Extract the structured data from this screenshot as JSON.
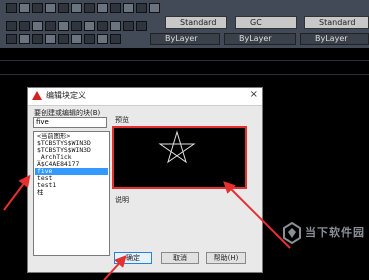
{
  "toolbar": {
    "text_style": "Standard",
    "dim_style": "GC",
    "table_style": "Standard",
    "layer_color": "ByLayer",
    "linetype": "ByLayer",
    "lineweight": "ByLayer"
  },
  "dialog": {
    "title": "编辑块定义",
    "prompt_label": "要创建或编辑的块(B)",
    "block_name_value": "five",
    "list_items": [
      "<当前图形>",
      "$TCBSTYS$WIN3D",
      "$TCBSTYS$WIN3D",
      "_ArchTick",
      "A$C4AE84177",
      "five",
      "test",
      "test1",
      "柱"
    ],
    "selected_item": "five",
    "preview_label": "预览",
    "description_label": "说明",
    "ok_label": "确定",
    "cancel_label": "取消",
    "help_label": "帮助(H)",
    "close_glyph": "×"
  },
  "watermark": {
    "text": "当下软件园"
  },
  "colors": {
    "accent_red": "#e53030",
    "selection_blue": "#3399ff",
    "toolbar_bg": "#424a57"
  }
}
